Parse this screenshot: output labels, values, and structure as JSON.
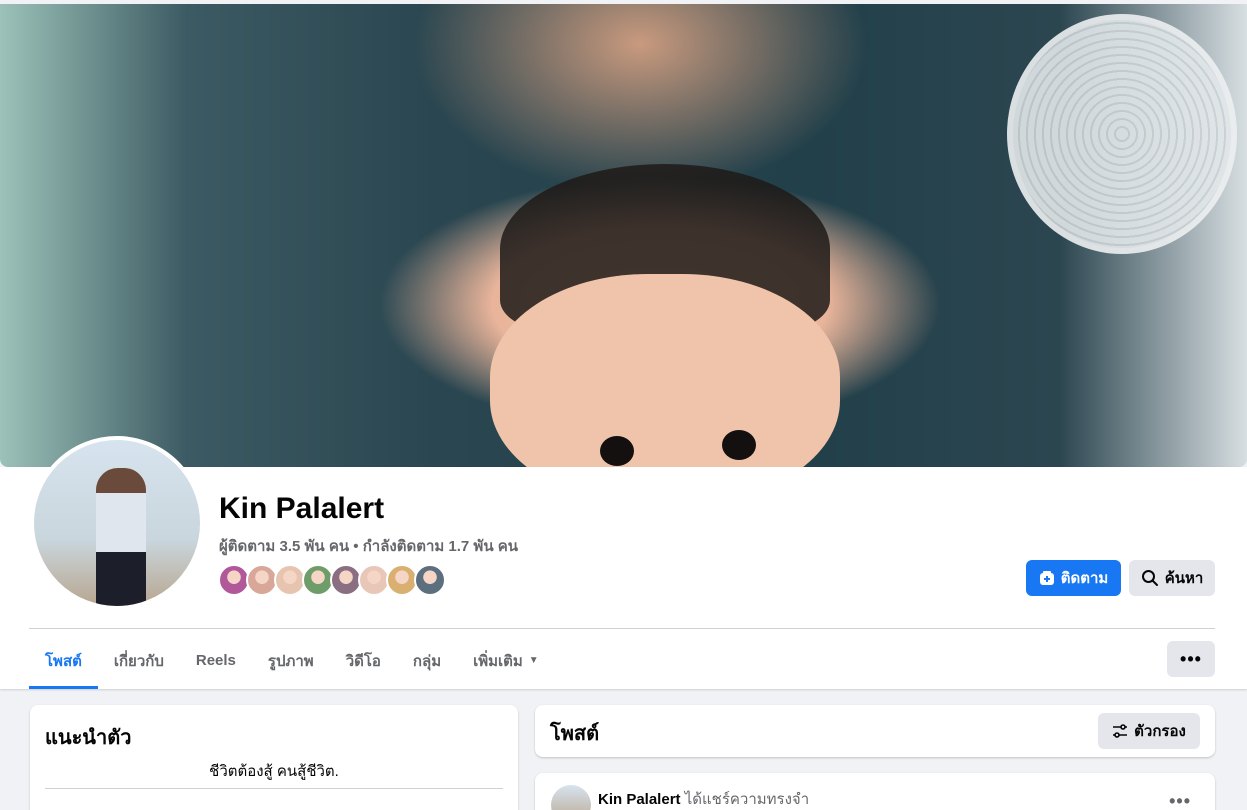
{
  "profile": {
    "name": "Kin Palalert",
    "stats": "ผู้ติดตาม 3.5 พัน คน • กำลังติดตาม 1.7 พัน คน",
    "friend_colors": [
      "#b0589a",
      "#d9a79a",
      "#e6c4b0",
      "#6f9d6a",
      "#8a6f82",
      "#e8c7b8",
      "#d9b070",
      "#5b6f7e"
    ]
  },
  "actions": {
    "follow_label": "ติดตาม",
    "search_label": "ค้นหา"
  },
  "tabs": [
    {
      "label": "โพสต์",
      "active": true
    },
    {
      "label": "เกี่ยวกับ"
    },
    {
      "label": "Reels"
    },
    {
      "label": "รูปภาพ"
    },
    {
      "label": "วิดีโอ"
    },
    {
      "label": "กลุ่ม"
    },
    {
      "label": "เพิ่มเติม"
    }
  ],
  "more_button": "•••",
  "intro": {
    "title": "แนะนำตัว",
    "bio": "ชีวิตต้องสู้ คนสู้ชีวิต."
  },
  "posts": {
    "title": "โพสต์",
    "filter_label": "ตัวกรอง",
    "first_post": {
      "author": "Kin Palalert",
      "action": "ได้แชร์ความทรงจำ",
      "more": "•••"
    }
  },
  "colors": {
    "accent": "#1877f2",
    "page_bg": "#f0f2f5",
    "secondary_button": "#e4e6eb"
  },
  "icons": {
    "follow": "user-plus-icon",
    "search": "search-icon",
    "filter": "sliders-icon",
    "dropdown": "caret-down-icon"
  }
}
